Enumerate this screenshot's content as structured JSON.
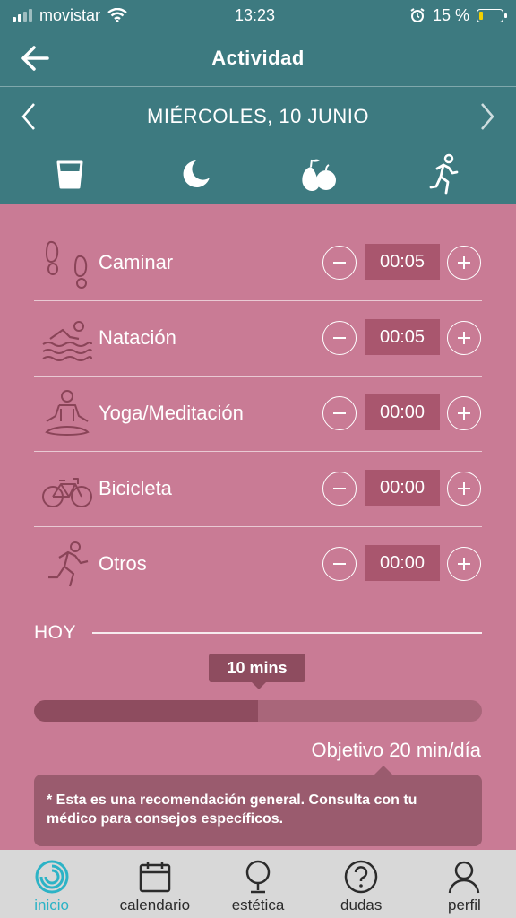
{
  "status": {
    "carrier": "movistar",
    "time": "13:23",
    "battery": "15 %"
  },
  "header": {
    "title": "Actividad"
  },
  "date": {
    "label": "MIÉRCOLES, 10 JUNIO"
  },
  "tabs": [
    {
      "icon": "water-glass-icon"
    },
    {
      "icon": "moon-icon"
    },
    {
      "icon": "fruit-icon"
    },
    {
      "icon": "running-icon",
      "active": true
    }
  ],
  "activities": [
    {
      "label": "Caminar",
      "time": "00:05",
      "icon": "footprints-icon"
    },
    {
      "label": "Natación",
      "time": "00:05",
      "icon": "swimmer-icon"
    },
    {
      "label": "Yoga/Meditación",
      "time": "00:00",
      "icon": "yoga-icon"
    },
    {
      "label": "Bicicleta",
      "time": "00:00",
      "icon": "bicycle-icon"
    },
    {
      "label": "Otros",
      "time": "00:00",
      "icon": "runner-icon"
    }
  ],
  "today": {
    "label": "HOY",
    "value_label": "10 mins",
    "progress_fraction": 0.5,
    "goal": "Objetivo 20 min/día"
  },
  "note": "* Esta es una recomendación general. Consulta con tu médico para consejos específicos.",
  "bottom_nav": [
    {
      "label": "inicio",
      "icon": "home-ring-icon",
      "active": true
    },
    {
      "label": "calendario",
      "icon": "calendar-icon"
    },
    {
      "label": "estética",
      "icon": "mirror-icon"
    },
    {
      "label": "dudas",
      "icon": "question-icon"
    },
    {
      "label": "perfil",
      "icon": "user-icon"
    }
  ],
  "colors": {
    "teal": "#3d7a80",
    "pink": "#c97b95",
    "dark_pink": "#8e4c5f",
    "accent": "#2cb3c6"
  }
}
